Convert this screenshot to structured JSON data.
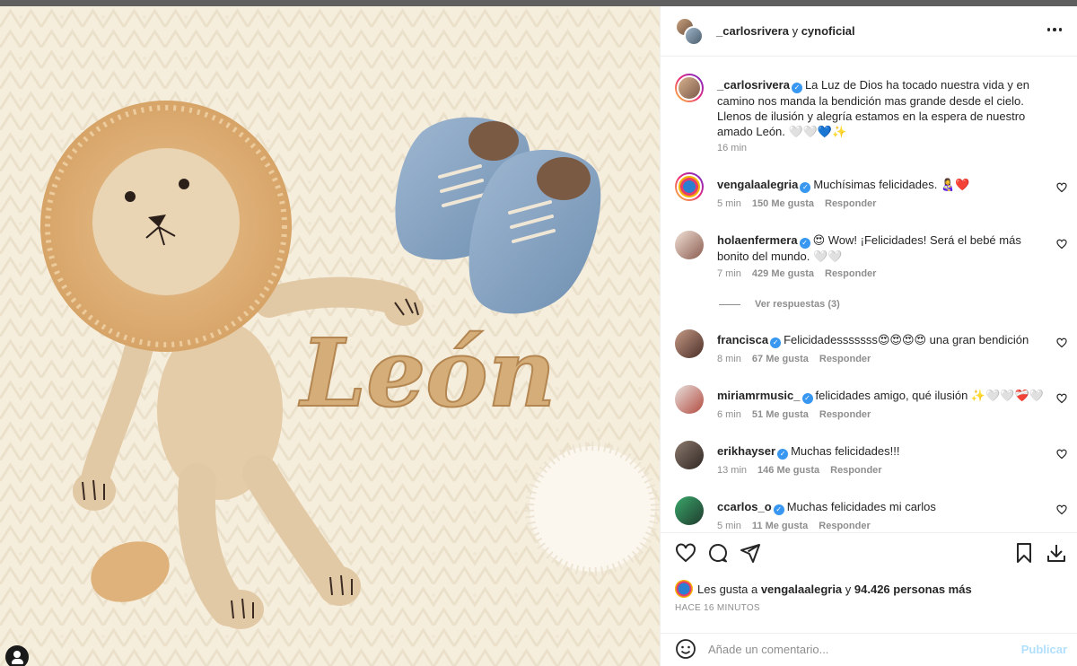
{
  "header": {
    "owner": "_carlosrivera",
    "connector": " y ",
    "collaborator": "cynoficial"
  },
  "caption": {
    "username": "_carlosrivera",
    "text": "La Luz de Dios ha tocado nuestra vida y en camino nos manda la bendición mas grande desde el cielo. Llenos de ilusión y alegría estamos en la espera de nuestro amado León. 🤍🤍💙✨",
    "time": "16 min"
  },
  "comments": [
    {
      "username": "vengalaalegria",
      "text": "Muchísimas felicidades. 👩‍🍼❤️",
      "time": "5 min",
      "likes": "150 Me gusta",
      "reply": "Responder"
    },
    {
      "username": "holaenfermera",
      "text": "😍 Wow! ¡Felicidades! Será el bebé más bonito del mundo. 🤍🤍",
      "time": "7 min",
      "likes": "429 Me gusta",
      "reply": "Responder",
      "view_replies": "Ver respuestas (3)"
    },
    {
      "username": "francisca",
      "text": "Felicidadesssssss😍😍😍😍 una gran bendición",
      "time": "8 min",
      "likes": "67 Me gusta",
      "reply": "Responder"
    },
    {
      "username": "miriamrmusic_",
      "text": "felicidades amigo, qué ilusión ✨🤍🤍❤️‍🩹🤍",
      "time": "6 min",
      "likes": "51 Me gusta",
      "reply": "Responder"
    },
    {
      "username": "erikhayser",
      "text": "Muchas felicidades!!!",
      "time": "13 min",
      "likes": "146 Me gusta",
      "reply": "Responder"
    },
    {
      "username": "ccarlos_o",
      "text": "Muchas felicidades mi carlos",
      "time": "5 min",
      "likes": "11 Me gusta",
      "reply": "Responder"
    }
  ],
  "likes": {
    "prefix": "Les gusta a ",
    "user": "vengalaalegria",
    "middle": " y ",
    "others": "94.426 personas más"
  },
  "posted_ago": "HACE 16 MINUTOS",
  "comment_box": {
    "placeholder": "Añade un comentario...",
    "publish": "Publicar"
  },
  "photo": {
    "embroidered_name": "León"
  },
  "colors": {
    "verified": "#3897f0",
    "publish_disabled": "#b2dffc",
    "meta_gray": "#8e8e8e"
  },
  "icons": [
    "heart-icon",
    "comment-icon",
    "share-icon",
    "bookmark-icon",
    "download-icon",
    "emoji-icon",
    "more-icon",
    "verified-icon",
    "profile-icon"
  ]
}
